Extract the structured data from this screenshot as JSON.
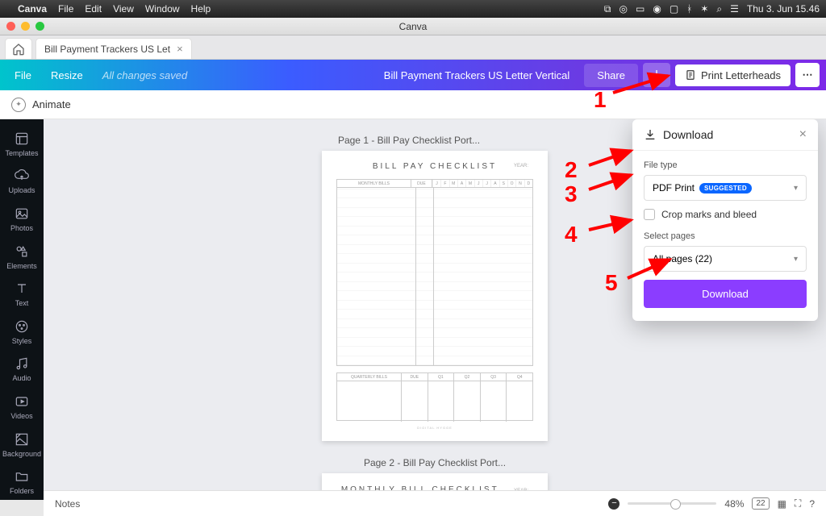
{
  "menubar": {
    "appname": "Canva",
    "items": [
      "File",
      "Edit",
      "View",
      "Window",
      "Help"
    ],
    "clock": "Thu 3. Jun  15.46"
  },
  "window_title": "Canva",
  "tab": {
    "label": "Bill Payment Trackers US Let"
  },
  "toolbar": {
    "file": "File",
    "resize": "Resize",
    "saved": "All changes saved",
    "docname": "Bill Payment Trackers US Letter Vertical",
    "share": "Share",
    "print": "Print Letterheads"
  },
  "subbar": {
    "animate": "Animate"
  },
  "sidebar": {
    "items": [
      {
        "label": "Templates"
      },
      {
        "label": "Uploads"
      },
      {
        "label": "Photos"
      },
      {
        "label": "Elements"
      },
      {
        "label": "Text"
      },
      {
        "label": "Styles"
      },
      {
        "label": "Audio"
      },
      {
        "label": "Videos"
      },
      {
        "label": "Background"
      },
      {
        "label": "Folders"
      }
    ]
  },
  "pages": {
    "p1_label": "Page 1 - Bill Pay Checklist Port...",
    "p2_label": "Page 2 - Bill Pay Checklist Port..."
  },
  "doc1": {
    "title": "BILL PAY CHECKLIST",
    "year": "YEAR:",
    "col_monthly": "MONTHLY BILLS",
    "col_due": "DUE",
    "months": [
      "J",
      "F",
      "M",
      "A",
      "M",
      "J",
      "J",
      "A",
      "S",
      "O",
      "N",
      "D"
    ],
    "col_quarterly": "QUARTERLY BILLS",
    "quarters": [
      "Q1",
      "Q2",
      "Q3",
      "Q4"
    ],
    "footer": "DIGITAL HYGGE"
  },
  "doc2": {
    "title": "MONTHLY BILL CHECKLIST",
    "year": "YEAR:"
  },
  "download": {
    "title": "Download",
    "filetype_label": "File type",
    "filetype_value": "PDF Print",
    "suggested": "SUGGESTED",
    "crop": "Crop marks and bleed",
    "selectpages_label": "Select pages",
    "selectpages_value": "All pages (22)",
    "button": "Download"
  },
  "bottombar": {
    "notes": "Notes",
    "zoom": "48%",
    "pagecount": "22"
  },
  "annotations": {
    "n1": "1",
    "n2": "2",
    "n3": "3",
    "n4": "4",
    "n5": "5"
  }
}
